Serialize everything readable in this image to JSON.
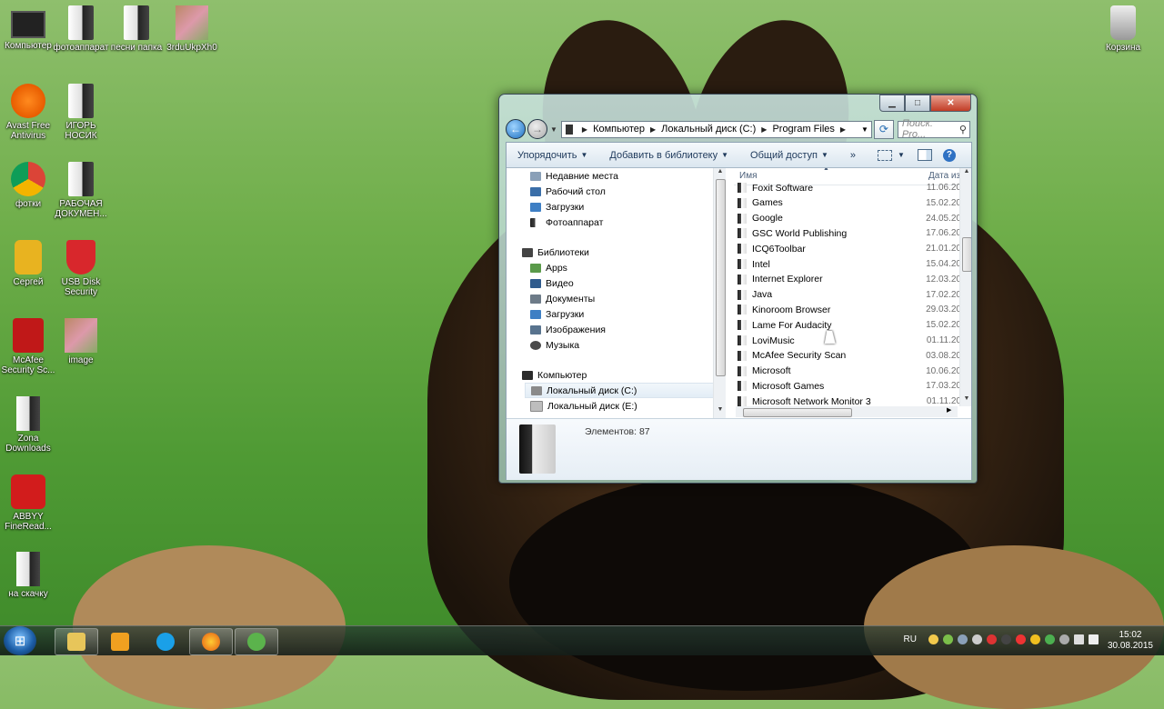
{
  "desktop": {
    "icons": [
      {
        "label": "Компьютер",
        "icon": "computer-icon"
      },
      {
        "label": "фотоаппарат",
        "icon": "folder-icon"
      },
      {
        "label": "песни папка",
        "icon": "folder-icon"
      },
      {
        "label": "3rduUkpXh0",
        "icon": "photo-icon"
      },
      {
        "label": "Avast Free Antivirus",
        "icon": "avast-icon"
      },
      {
        "label": "ИГОРЬ НОСИК",
        "icon": "folder-icon"
      },
      {
        "label": "фотки",
        "icon": "chrome-icon"
      },
      {
        "label": "РАБОЧАЯ ДОКУМЕН...",
        "icon": "folder-icon"
      },
      {
        "label": "Сергей",
        "icon": "lock-icon"
      },
      {
        "label": "USB Disk Security",
        "icon": "shield-icon"
      },
      {
        "label": "McAfee Security Sc...",
        "icon": "mcafee-icon"
      },
      {
        "label": "image",
        "icon": "photo-icon"
      },
      {
        "label": "Zona Downloads",
        "icon": "folder-icon"
      },
      {
        "label": "ABBYY FineRead...",
        "icon": "abbyy-icon"
      },
      {
        "label": "на скачку",
        "icon": "folder-icon"
      },
      {
        "label": "Корзина",
        "icon": "trash-icon"
      }
    ]
  },
  "explorer": {
    "caption": {
      "minimize": "▁",
      "maximize": "□",
      "close": "✕"
    },
    "address": {
      "segments": [
        "Компьютер",
        "Локальный диск (C:)",
        "Program Files"
      ],
      "search_placeholder": "Поиск: Pro..."
    },
    "toolbar": {
      "organize": "Упорядочить",
      "add_to_library": "Добавить в библиотеку",
      "share": "Общий доступ",
      "more": "»"
    },
    "nav": {
      "favorites": [
        "Недавние места",
        "Рабочий стол",
        "Загрузки",
        "Фотоаппарат"
      ],
      "libraries_label": "Библиотеки",
      "libraries": [
        "Apps",
        "Видео",
        "Документы",
        "Загрузки",
        "Изображения",
        "Музыка"
      ],
      "computer_label": "Компьютер",
      "drives": [
        "Локальный диск (C:)",
        "Локальный диск (E:)"
      ]
    },
    "files": {
      "col_name": "Имя",
      "col_date": "Дата из",
      "rows": [
        {
          "name": "Foxit Software",
          "date": "11.06.20"
        },
        {
          "name": "Games",
          "date": "15.02.20"
        },
        {
          "name": "Google",
          "date": "24.05.20"
        },
        {
          "name": "GSC World Publishing",
          "date": "17.06.20"
        },
        {
          "name": "ICQ6Toolbar",
          "date": "21.01.20"
        },
        {
          "name": "Intel",
          "date": "15.04.20"
        },
        {
          "name": "Internet Explorer",
          "date": "12.03.20"
        },
        {
          "name": "Java",
          "date": "17.02.20"
        },
        {
          "name": "Kinoroom Browser",
          "date": "29.03.20"
        },
        {
          "name": "Lame For Audacity",
          "date": "15.02.20"
        },
        {
          "name": "LoviMusic",
          "date": "01.11.20"
        },
        {
          "name": "McAfee Security Scan",
          "date": "03.08.20"
        },
        {
          "name": "Microsoft",
          "date": "10.06.20"
        },
        {
          "name": "Microsoft Games",
          "date": "17.03.20"
        },
        {
          "name": "Microsoft Network Monitor 3",
          "date": "01.11.20"
        }
      ]
    },
    "details": {
      "items_count": "Элементов: 87"
    }
  },
  "taskbar": {
    "language": "RU",
    "time": "15:02",
    "date": "30.08.2015"
  }
}
